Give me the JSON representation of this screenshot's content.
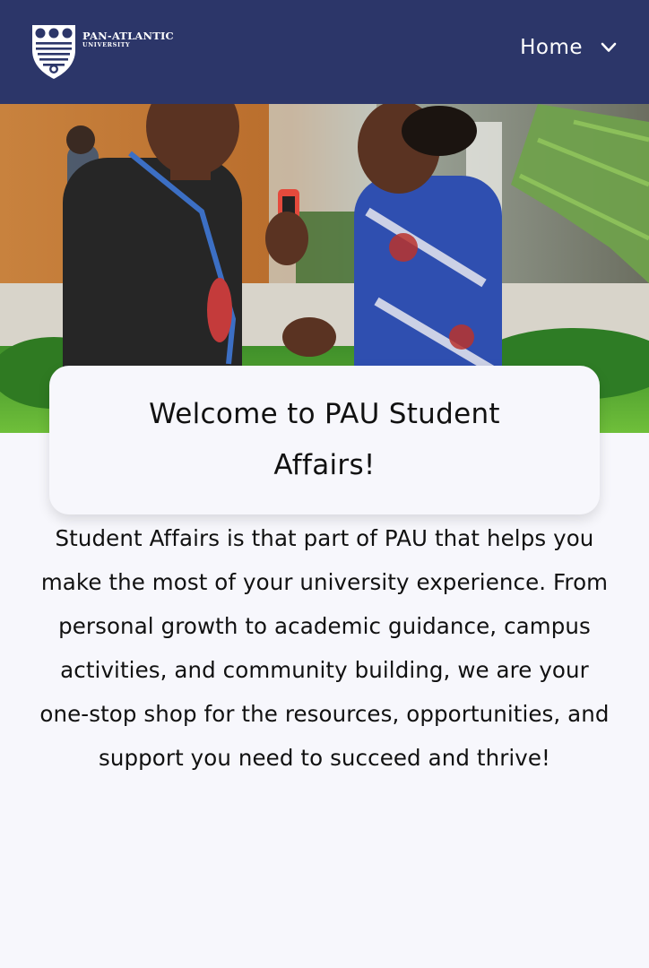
{
  "header": {
    "logo": {
      "name": "PAN-ATLANTIC",
      "sub": "UNIVERSITY"
    },
    "nav": {
      "label": "Home",
      "icon": "chevron-down-icon"
    },
    "colors": {
      "background": "#2c3669",
      "text": "#ffffff"
    }
  },
  "hero": {
    "image": "students-talking-photo"
  },
  "welcome": {
    "title": "Welcome to PAU Student Affairs!"
  },
  "intro": {
    "text": "Student Affairs is that part of PAU that helps you make the most of your university experience. From personal growth to academic guidance, campus activities, and community building, we are your one-stop shop for the resources, opportunities, and support you need to succeed and thrive!"
  },
  "page": {
    "background": "#f7f7fc"
  }
}
